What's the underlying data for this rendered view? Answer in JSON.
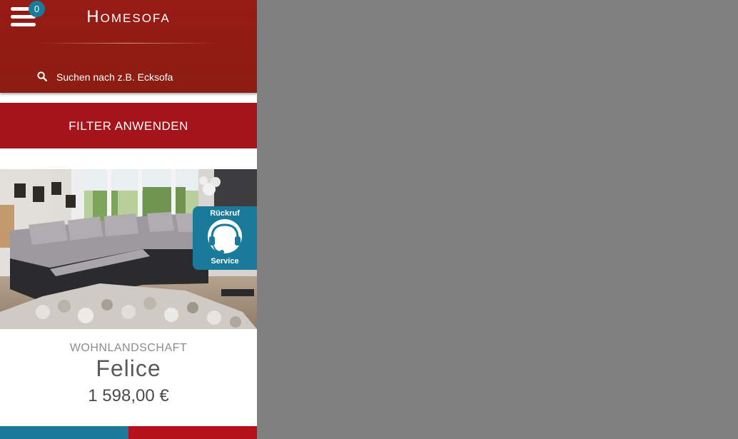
{
  "header": {
    "logo": "Homesofa",
    "cart_count": "0",
    "search_placeholder": "Suchen nach z.B. Ecksofa"
  },
  "filter": {
    "label": "FILTER ANWENDEN"
  },
  "callback": {
    "line1": "Rückruf",
    "line2": "Service",
    "icon": "headset-icon"
  },
  "product": {
    "category": "WOHNLANDSCHAFT",
    "name": "Felice",
    "price": "1 598,00 €"
  },
  "colors": {
    "header": "#961b15",
    "accent_red": "#a4141a",
    "accent_blue": "#1a7a99",
    "overlay": "#808080"
  }
}
